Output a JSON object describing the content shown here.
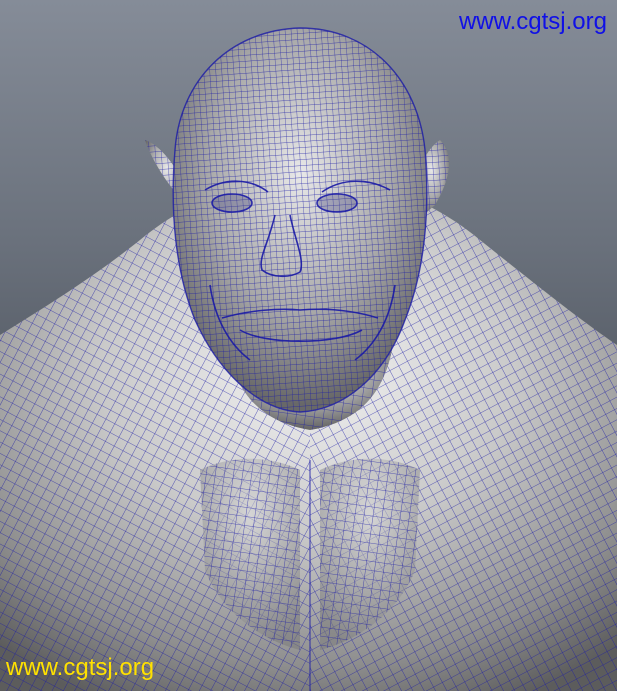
{
  "viewport": {
    "subject": "3D wireframe-on-shaded character bust",
    "wire_color": "#1a1aa6",
    "background_top": "#858c98",
    "background_bottom": "#2e3238"
  },
  "watermarks": {
    "top_right": {
      "text": "www.cgtsj.org",
      "color": "#1010e6"
    },
    "bottom_left": {
      "text": "www.cgtsj.org",
      "color": "#ffe100"
    }
  }
}
